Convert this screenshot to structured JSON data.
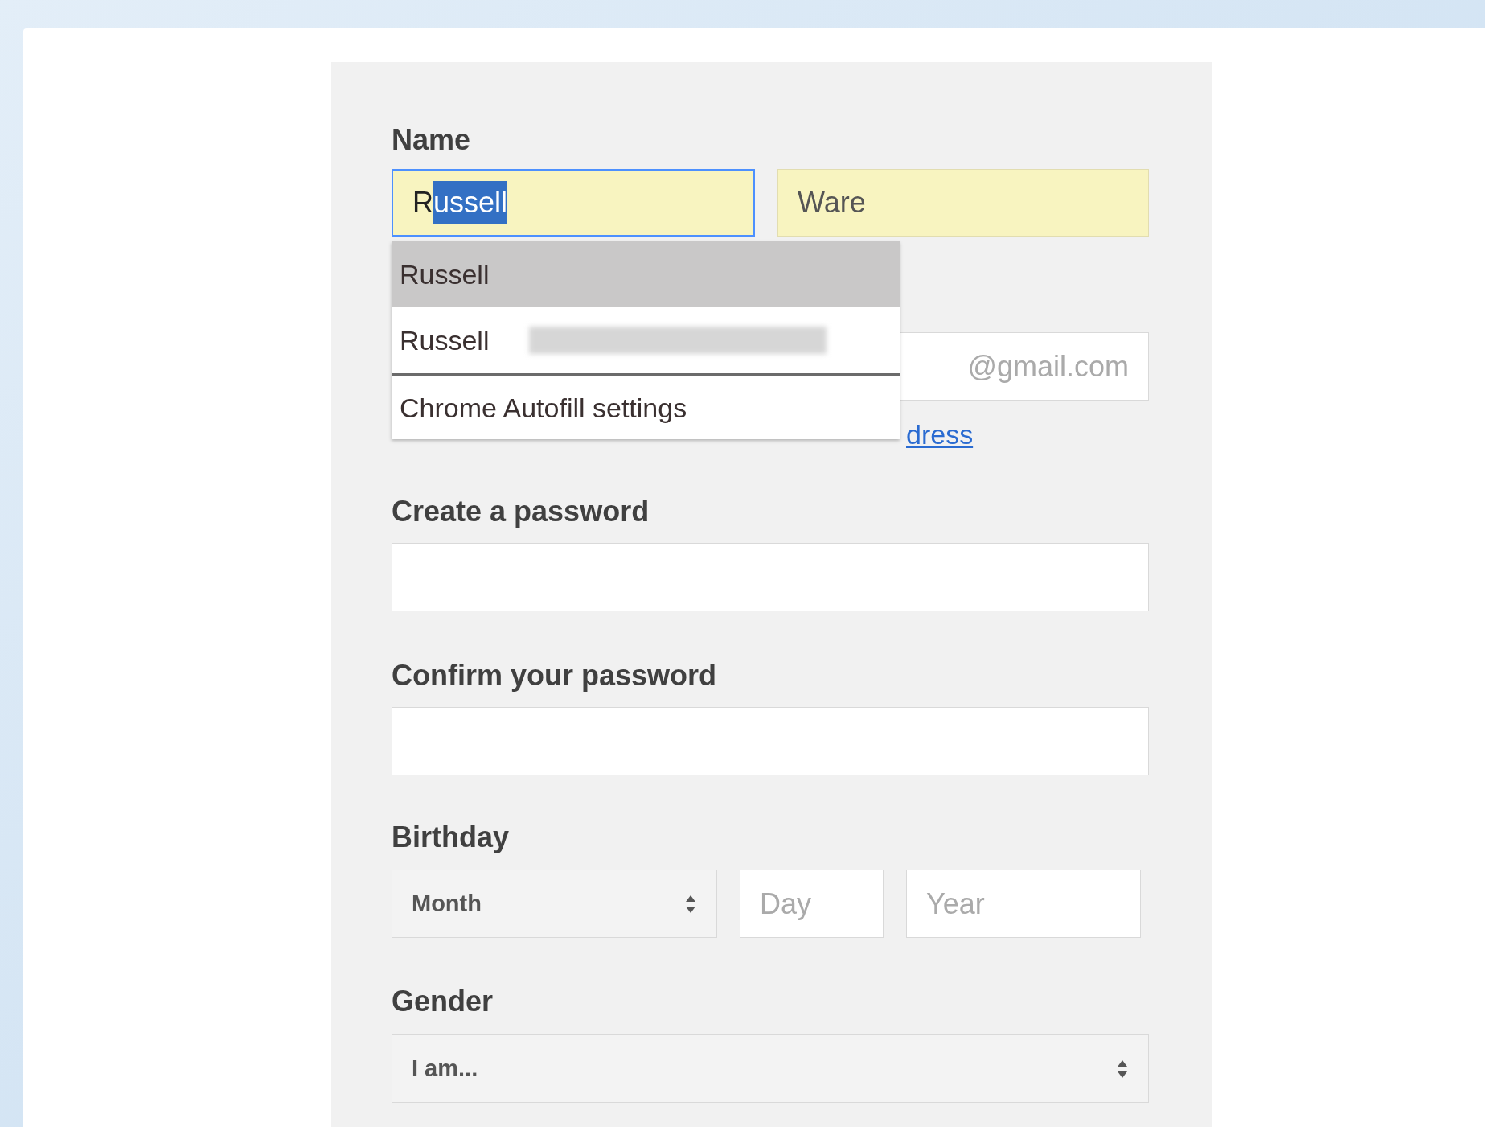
{
  "name_section": {
    "label": "Name",
    "first_name": {
      "typed": "R",
      "autofill_selected": "ussell",
      "focused": true,
      "autofilled": true
    },
    "last_name": {
      "value": "Ware",
      "focused": false,
      "autofilled": true
    }
  },
  "autofill_dropdown": [
    {
      "kind": "suggestion",
      "label": "Russell",
      "selected": true,
      "redacted_detail": false
    },
    {
      "kind": "suggestion",
      "label": "Russell",
      "selected": false,
      "redacted_detail": true
    },
    {
      "kind": "settings",
      "label": "Chrome Autofill settings",
      "selected": false
    }
  ],
  "username": {
    "suffix": "@gmail.com"
  },
  "alt_email_link": "dress",
  "password": {
    "label": "Create a password"
  },
  "confirm_password": {
    "label": "Confirm your password"
  },
  "birthday": {
    "label": "Birthday",
    "month": "Month",
    "day_placeholder": "Day",
    "year_placeholder": "Year"
  },
  "gender": {
    "label": "Gender",
    "value": "I am..."
  }
}
